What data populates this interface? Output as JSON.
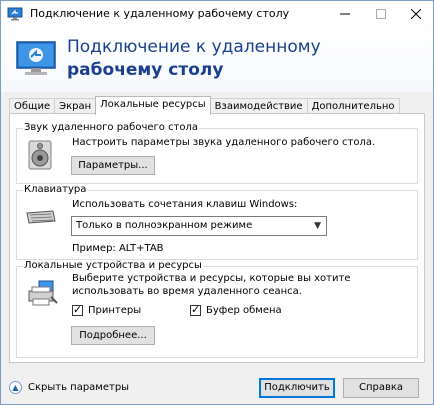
{
  "window": {
    "title": "Подключение к удаленному рабочему столу"
  },
  "banner": {
    "line1": "Подключение к удаленному",
    "line2": "рабочему столу"
  },
  "tabs": [
    "Общие",
    "Экран",
    "Локальные ресурсы",
    "Взаимодействие",
    "Дополнительно"
  ],
  "audio": {
    "title": "Звук удаленного рабочего стола",
    "description": "Настроить параметры звука удаленного рабочего стола.",
    "button": "Параметры..."
  },
  "keyboard": {
    "title": "Клавиатура",
    "description": "Использовать сочетания клавиш Windows:",
    "selected": "Только в полноэкранном режиме",
    "example": "Пример: ALT+TAB"
  },
  "devices": {
    "title": "Локальные устройства и ресурсы",
    "description_line1": "Выберите устройства и ресурсы, которые вы хотите",
    "description_line2": "использовать во время удаленного сеанса.",
    "printers_label": "Принтеры",
    "printers_checked": true,
    "clipboard_label": "Буфер обмена",
    "clipboard_checked": true,
    "more_button": "Подробнее..."
  },
  "footer": {
    "hide_label": "Скрыть параметры",
    "connect_button": "Подключить",
    "help_button": "Справка"
  },
  "colors": {
    "accent": "#1a3f8c",
    "focus": "#0078d7"
  }
}
